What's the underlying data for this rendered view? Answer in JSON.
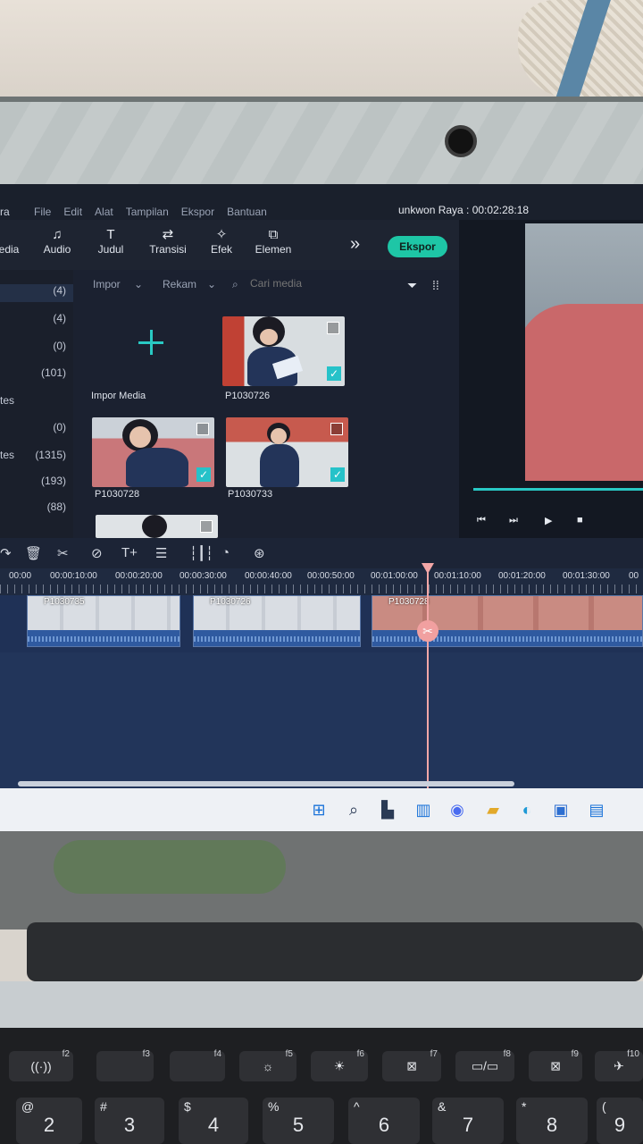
{
  "app": {
    "brand_fragment": "ra",
    "menu": [
      "File",
      "Edit",
      "Alat",
      "Tampilan",
      "Ekspor",
      "Bantuan"
    ],
    "project_title": "unkwon Raya : 00:02:28:18"
  },
  "toolbar": {
    "items": [
      {
        "label": "edia",
        "icon": "media-icon"
      },
      {
        "label": "Audio",
        "icon": "audio-icon"
      },
      {
        "label": "Judul",
        "icon": "title-icon"
      },
      {
        "label": "Transisi",
        "icon": "transition-icon"
      },
      {
        "label": "Efek",
        "icon": "effects-icon"
      },
      {
        "label": "Elemen",
        "icon": "elements-icon"
      }
    ],
    "more": "»",
    "export_label": "Ekspor"
  },
  "sidebar": {
    "categories": [
      {
        "label": "",
        "count": "(4)"
      },
      {
        "label": "",
        "count": "(4)"
      },
      {
        "label": "",
        "count": "(0)"
      },
      {
        "label": "",
        "count": "(101)"
      },
      {
        "label": "tes",
        "count": ""
      },
      {
        "label": "",
        "count": "(0)"
      },
      {
        "label": "tes",
        "count": "(1315)"
      },
      {
        "label": "",
        "count": "(193)"
      },
      {
        "label": "",
        "count": "(88)"
      }
    ]
  },
  "media": {
    "import_label": "Impor",
    "record_label": "Rekam",
    "search_placeholder": "Cari media",
    "import_media_label": "Impor Media",
    "clips": [
      {
        "name": "P1030726"
      },
      {
        "name": "P1030728"
      },
      {
        "name": "P1030733"
      }
    ]
  },
  "preview": {
    "progress": 1.0,
    "controls": [
      "⏮",
      "⏭",
      "▶",
      "■"
    ]
  },
  "timeline": {
    "ruler": [
      "00:00",
      "00:00:10:00",
      "00:00:20:00",
      "00:00:30:00",
      "00:00:40:00",
      "00:00:50:00",
      "00:01:00:00",
      "00:01:10:00",
      "00:01:20:00",
      "00:01:30:00",
      "00"
    ],
    "clips": [
      {
        "name": "P1030735"
      },
      {
        "name": "P1030726"
      },
      {
        "name": "P1030728"
      }
    ]
  },
  "keyboard": {
    "fn_row": [
      "f2",
      "f3",
      "f4",
      "f5",
      "f6",
      "f7",
      "f8",
      "f9",
      "f10"
    ],
    "num_row": [
      {
        "main": "2",
        "sym": "@"
      },
      {
        "main": "3",
        "sym": "#"
      },
      {
        "main": "4",
        "sym": "$"
      },
      {
        "main": "5",
        "sym": "%"
      },
      {
        "main": "6",
        "sym": "^"
      },
      {
        "main": "7",
        "sym": "&"
      },
      {
        "main": "8",
        "sym": "*"
      },
      {
        "main": "9",
        "sym": "("
      }
    ]
  }
}
